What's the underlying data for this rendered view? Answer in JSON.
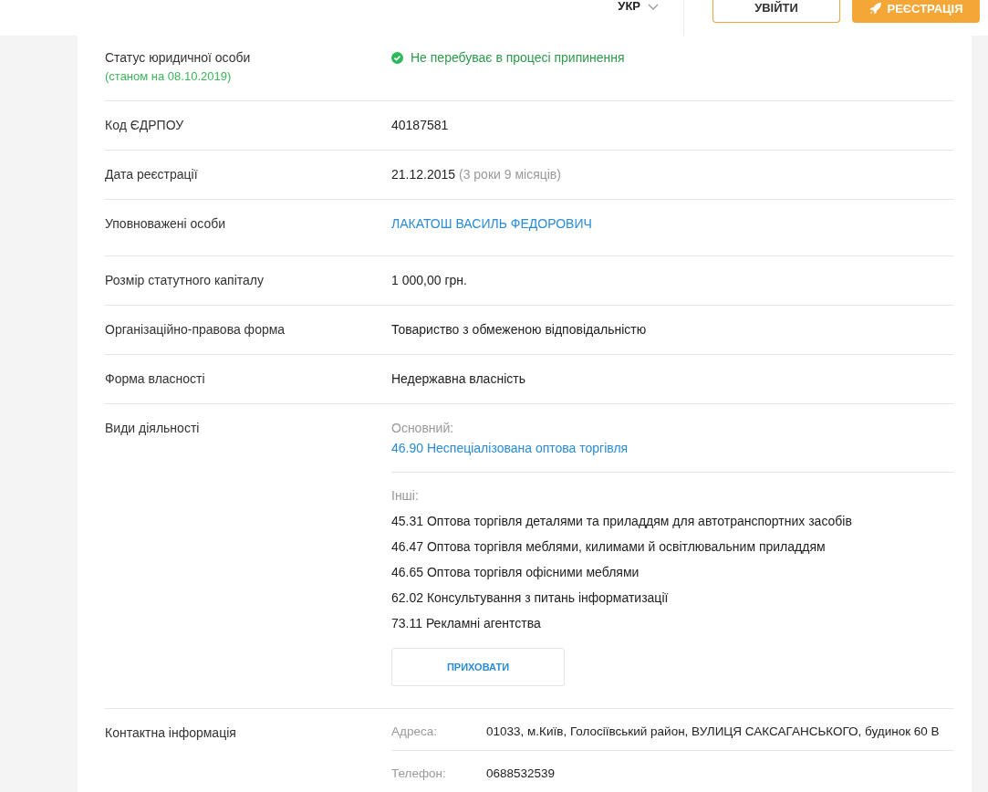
{
  "header": {
    "language": "УКР",
    "login": "УВІЙТИ",
    "register": "РЕЄСТРАЦІЯ"
  },
  "rows": [
    {
      "kind": "status",
      "label": "Статус юридичної особи",
      "note": "(станом на 08.10.2019)",
      "value": "Не перебуває в процесі припинення"
    },
    {
      "kind": "text",
      "label": "Код ЄДРПОУ",
      "value": "40187581"
    },
    {
      "kind": "text",
      "label": "Дата реєстрації",
      "value": "21.12.2015",
      "extra": "(3 роки 9 місяців)"
    },
    {
      "kind": "link",
      "label": "Уповноважені особи",
      "value": "ЛАКАТОШ ВАСИЛЬ ФЕДОРОВИЧ"
    },
    {
      "kind": "text",
      "label": "Розмір статутного капіталу",
      "value": "1 000,00 грн."
    },
    {
      "kind": "text",
      "label": "Організаційно-правова форма",
      "value": "Товариство з обмеженою відповідальністю"
    },
    {
      "kind": "text",
      "label": "Форма власності",
      "value": "Недержавна власність"
    },
    {
      "kind": "activities",
      "label": "Види діяльності",
      "main_label": "Основний:",
      "main": "46.90 Неспеціалізована оптова торгівля",
      "others_label": "Інші:",
      "others": [
        "45.31 Оптова торгівля деталями та приладдям для автотранспортних засобів",
        "46.47 Оптова торгівля меблями, килимами й освітлювальним приладдям",
        "46.65 Оптова торгівля офісними меблями",
        "62.02 Консультування з питань інформатизації",
        "73.11 Рекламні агентства"
      ],
      "toggle": "ПРИХОВАТИ"
    },
    {
      "kind": "contacts",
      "label": "Контактна інформація",
      "items": [
        {
          "label": "Адреса:",
          "value": "01033, м.Київ, Голосіївський район, ВУЛИЦЯ САКСАГАНСЬКОГО, будинок 60 В"
        },
        {
          "label": "Телефон:",
          "value": "0688532539"
        }
      ]
    }
  ]
}
